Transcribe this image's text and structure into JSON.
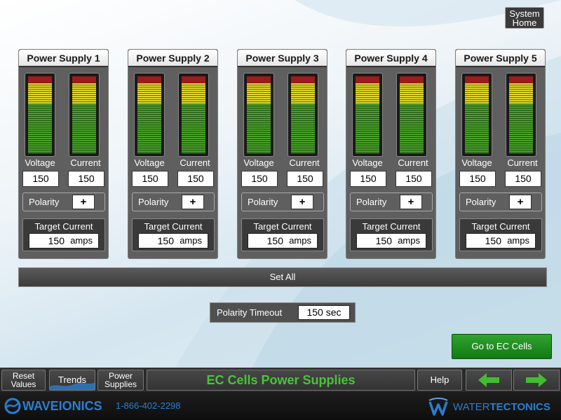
{
  "header": {
    "system_home_label": "System\nHome"
  },
  "power_supplies": [
    {
      "title": "Power Supply 1",
      "voltage_label": "Voltage",
      "current_label": "Current",
      "voltage": "150",
      "current": "150",
      "polarity_label": "Polarity",
      "polarity_value": "+",
      "target_label": "Target Current",
      "target_value": "150",
      "target_unit": "amps"
    },
    {
      "title": "Power Supply 2",
      "voltage_label": "Voltage",
      "current_label": "Current",
      "voltage": "150",
      "current": "150",
      "polarity_label": "Polarity",
      "polarity_value": "+",
      "target_label": "Target Current",
      "target_value": "150",
      "target_unit": "amps"
    },
    {
      "title": "Power Supply 3",
      "voltage_label": "Voltage",
      "current_label": "Current",
      "voltage": "150",
      "current": "150",
      "polarity_label": "Polarity",
      "polarity_value": "+",
      "target_label": "Target Current",
      "target_value": "150",
      "target_unit": "amps"
    },
    {
      "title": "Power Supply 4",
      "voltage_label": "Voltage",
      "current_label": "Current",
      "voltage": "150",
      "current": "150",
      "polarity_label": "Polarity",
      "polarity_value": "+",
      "target_label": "Target Current",
      "target_value": "150",
      "target_unit": "amps"
    },
    {
      "title": "Power Supply 5",
      "voltage_label": "Voltage",
      "current_label": "Current",
      "voltage": "150",
      "current": "150",
      "polarity_label": "Polarity",
      "polarity_value": "+",
      "target_label": "Target Current",
      "target_value": "150",
      "target_unit": "amps"
    }
  ],
  "controls": {
    "set_all_label": "Set All",
    "polarity_timeout_label": "Polarity Timeout",
    "polarity_timeout_value": "150 sec",
    "go_ec_cells_label": "Go to EC Cells"
  },
  "nav": {
    "reset_values_label": "Reset\nValues",
    "trends_label": "Trends",
    "power_supplies_label": "Power\nSupplies",
    "title": "EC Cells Power Supplies",
    "help_label": "Help",
    "back_icon": "left-arrow-icon",
    "forward_icon": "right-arrow-icon"
  },
  "footer": {
    "left_brand": "WAVEIONICS",
    "phone": "1-866-402-2298",
    "right_brand_a": "WATER",
    "right_brand_b": "TECTONICS"
  },
  "colors": {
    "accent_green": "#48c43a",
    "brand_blue": "#2a7ed0",
    "panel_gray": "#5f5f5f",
    "meter_red": "#9a1c1c",
    "meter_yellow": "#e0d72a",
    "meter_green": "#4aa22a"
  }
}
